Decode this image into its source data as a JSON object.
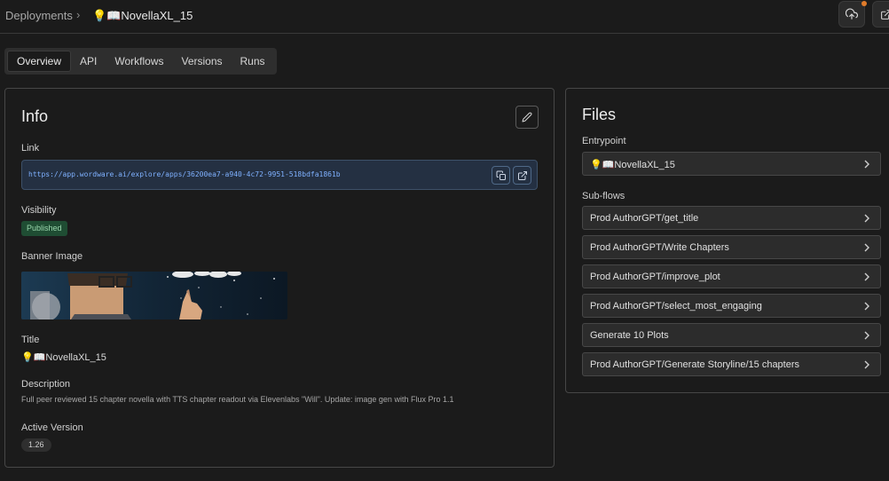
{
  "header": {
    "root": "Deployments",
    "separator": "›",
    "current_title": "💡📖NovellaXL_15"
  },
  "tabs": [
    "Overview",
    "API",
    "Workflows",
    "Versions",
    "Runs"
  ],
  "active_tab": "Overview",
  "info": {
    "heading": "Info",
    "link_label": "Link",
    "link_url": "https://app.wordware.ai/explore/apps/36200ea7-a940-4c72-9951-518bdfa1861b",
    "visibility_label": "Visibility",
    "visibility_value": "Published",
    "banner_label": "Banner Image",
    "title_label": "Title",
    "title_value": "💡📖NovellaXL_15",
    "description_label": "Description",
    "description_value": "Full peer reviewed 15 chapter novella with TTS chapter readout via Elevenlabs \"Will\". Update: image gen with Flux Pro 1.1",
    "active_version_label": "Active Version",
    "active_version_value": "1.26"
  },
  "files": {
    "heading": "Files",
    "entrypoint_label": "Entrypoint",
    "entrypoint": "💡📖NovellaXL_15",
    "subflows_label": "Sub-flows",
    "subflows": [
      "Prod AuthorGPT/get_title",
      "Prod AuthorGPT/Write Chapters",
      "Prod AuthorGPT/improve_plot",
      "Prod AuthorGPT/select_most_engaging",
      "Generate 10 Plots",
      "Prod AuthorGPT/Generate Storyline/15 chapters"
    ]
  },
  "colors": {
    "background": "#1b1b1b",
    "link": "#7fb1ff",
    "published": "#1f4d33",
    "notification": "#e07b2a"
  },
  "icons": [
    "upload-cloud-icon",
    "external-link-icon",
    "pencil-icon",
    "copy-icon",
    "chevron-right-icon"
  ]
}
